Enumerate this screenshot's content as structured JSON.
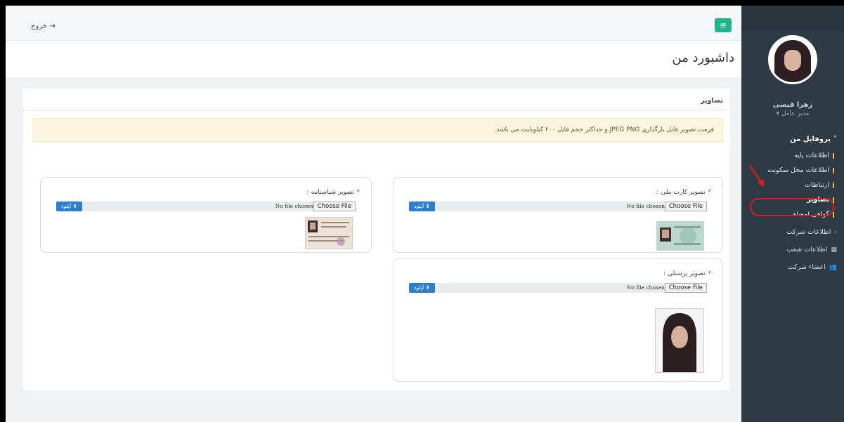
{
  "topbar": {
    "logout_label": "خروج",
    "menu_icon": "bars-icon",
    "logout_icon": "sign-out-icon"
  },
  "page": {
    "title": "داشبورد من"
  },
  "sidebar": {
    "user_name": "زهرا قیصی",
    "user_role": "مدیر عامل ▾",
    "profile_section": "پروفایل من",
    "profile_items": [
      {
        "label": "اطلاعات پایه"
      },
      {
        "label": "اطلاعات محل سکونت"
      },
      {
        "label": "ارتباطات"
      },
      {
        "label": "تصاویر"
      },
      {
        "label": "گواهی امضاء"
      }
    ],
    "company_section": "اطلاعات شرکت",
    "branches_label": "اطلاعات شعب",
    "members_label": "اعضاء شرکت"
  },
  "panel": {
    "title": "تصاویر",
    "alert": "فرمت تصویر فایل بارگذاری JPEG PNG و حداکثر حجم فایل ۲۰۰ کیلوبایت می باشد."
  },
  "cards": {
    "national_card": {
      "label": "تصویر کارت ملی :"
    },
    "birth_certificate": {
      "label": "تصویر شناسنامه :"
    },
    "personnel": {
      "label": "تصویر پرسنلی :"
    }
  },
  "file_input": {
    "button_label": "Choose File",
    "status": "No file chosen"
  },
  "upload": {
    "label": "آپلود",
    "icon": "upload-icon"
  },
  "colors": {
    "sidebar": "#2e3a44",
    "accent": "#1fb58f",
    "upload": "#2c7fd0",
    "alert_bg": "#fcf6e0",
    "highlight": "#d81c1c"
  }
}
